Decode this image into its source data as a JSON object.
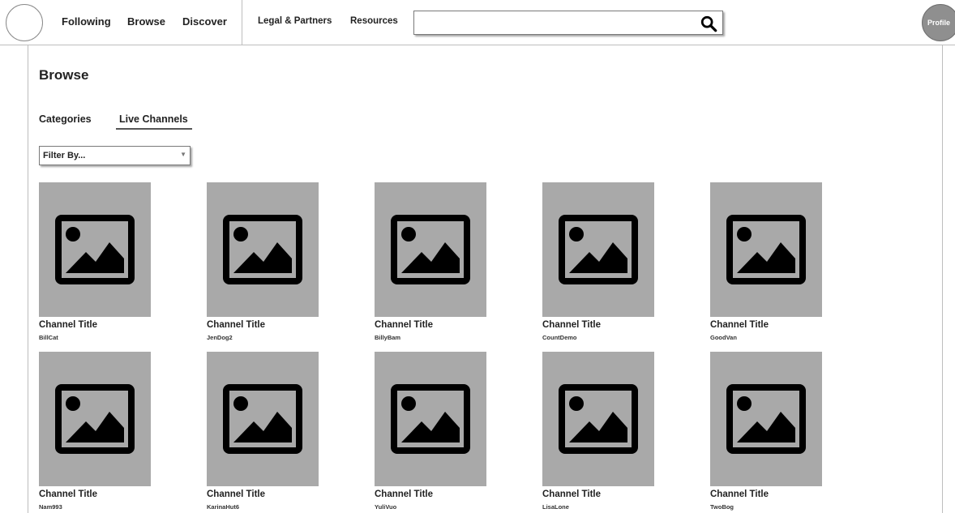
{
  "header": {
    "nav_primary": [
      "Following",
      "Browse",
      "Discover"
    ],
    "nav_secondary": [
      "Legal & Partners",
      "Resources"
    ],
    "search": {
      "value": "",
      "placeholder": ""
    },
    "profile_label": "Profile"
  },
  "page": {
    "title": "Browse",
    "tabs": [
      {
        "label": "Categories",
        "active": false
      },
      {
        "label": "Live Channels",
        "active": true
      }
    ],
    "filter": {
      "selected": "Filter By..."
    }
  },
  "channels": [
    {
      "title": "Channel Title",
      "user": "BillCat"
    },
    {
      "title": "Channel Title",
      "user": "JenDog2"
    },
    {
      "title": "Channel Title",
      "user": "BillyBam"
    },
    {
      "title": "Channel Title",
      "user": "CountDemo"
    },
    {
      "title": "Channel Title",
      "user": "GoodVan"
    },
    {
      "title": "Channel Title",
      "user": "Nam993"
    },
    {
      "title": "Channel Title",
      "user": "KarinaHut6"
    },
    {
      "title": "Channel Title",
      "user": "YuliVuo"
    },
    {
      "title": "Channel Title",
      "user": "LisaLone"
    },
    {
      "title": "Channel Title",
      "user": "TwoBog"
    }
  ],
  "icons": {
    "search": "search-icon",
    "thumbnail": "image-placeholder-icon",
    "dropdown": "chevron-down-icon"
  },
  "colors": {
    "thumbnail_bg": "#a9a9a9",
    "profile_bg": "#8f8f8f",
    "divider": "#bdbdbd"
  }
}
